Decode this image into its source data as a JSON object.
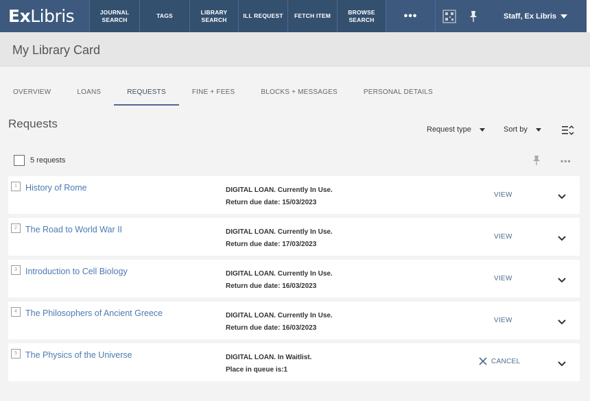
{
  "topbar": {
    "logo_ex": "Ex",
    "logo_libris": "Libris",
    "nav": [
      {
        "label": "JOURNAL\nSEARCH"
      },
      {
        "label": "TAGS"
      },
      {
        "label": "LIBRARY\nSEARCH"
      },
      {
        "label": "ILL REQUEST"
      },
      {
        "label": "FETCH ITEM"
      },
      {
        "label": "BROWSE\nSEARCH"
      }
    ],
    "more": "•••",
    "user": "Staff, Ex Libris"
  },
  "page_title": "My Library Card",
  "tabs": [
    {
      "label": "OVERVIEW"
    },
    {
      "label": "LOANS"
    },
    {
      "label": "REQUESTS"
    },
    {
      "label": "FINE + FEES"
    },
    {
      "label": "BLOCKS + MESSAGES"
    },
    {
      "label": "PERSONAL DETAILS"
    }
  ],
  "section_title": "Requests",
  "filters": {
    "request_type": "Request type",
    "sort_by": "Sort by"
  },
  "count_label": "5 requests",
  "requests": [
    {
      "num": "1",
      "title": "History of Rome",
      "status1": "DIGITAL LOAN. Currently In Use.",
      "status2": "Return due date: 15/03/2023",
      "action": "VIEW"
    },
    {
      "num": "2",
      "title": "The Road to World War II",
      "status1": "DIGITAL LOAN. Currently In Use.",
      "status2": "Return due date: 17/03/2023",
      "action": "VIEW"
    },
    {
      "num": "3",
      "title": "Introduction to Cell Biology",
      "status1": "DIGITAL LOAN. Currently In Use.",
      "status2": "Return due date: 16/03/2023",
      "action": "VIEW"
    },
    {
      "num": "4",
      "title": "The Philosophers of Ancient Greece",
      "status1": "DIGITAL LOAN. Currently In Use.",
      "status2": "Return due date: 16/03/2023",
      "action": "VIEW"
    },
    {
      "num": "5",
      "title": "The Physics of the Universe",
      "status1": "DIGITAL LOAN. In Waitlist.",
      "status2": "Place in queue is:1",
      "action": "CANCEL"
    }
  ],
  "colors": {
    "topbar": "#3d5a7e",
    "link": "#4a7bb3",
    "accent": "#4e6a8e"
  }
}
